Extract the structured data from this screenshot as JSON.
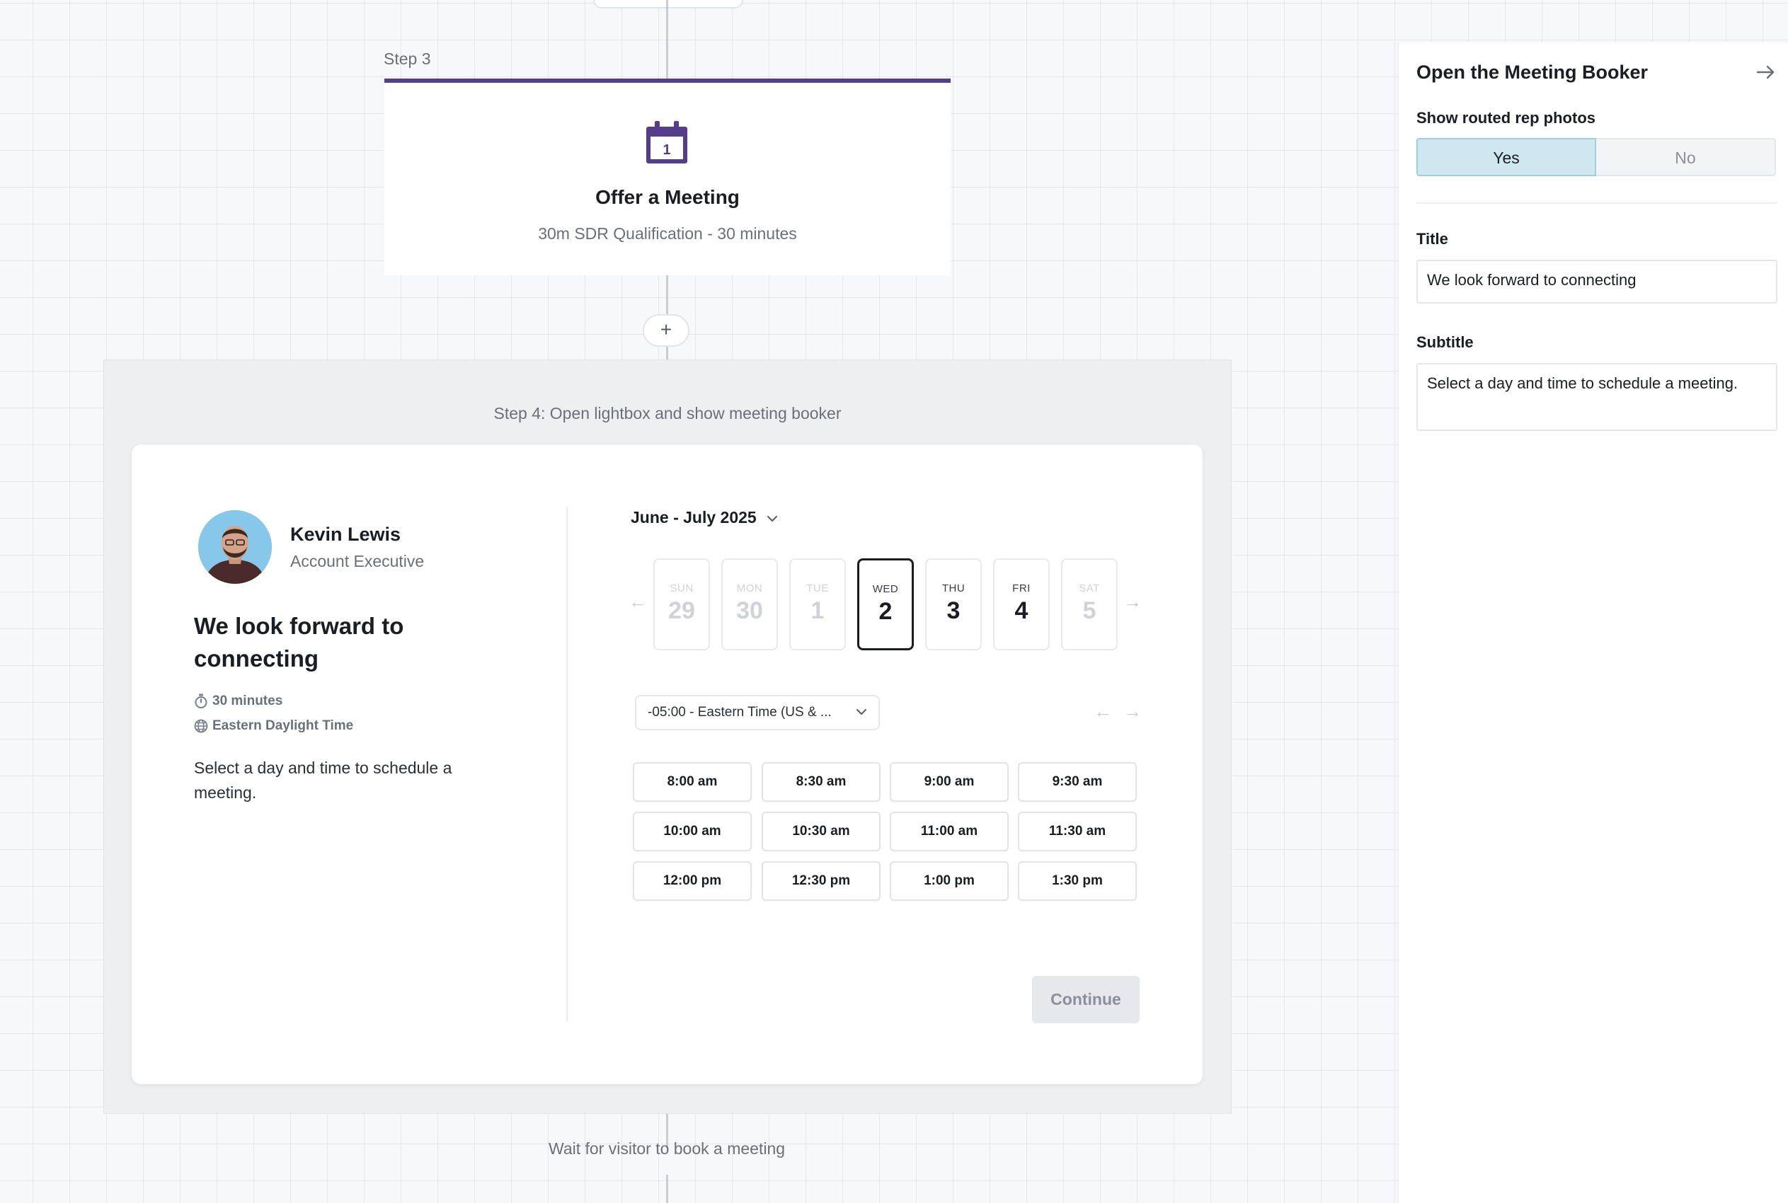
{
  "flow": {
    "step3": {
      "label": "Step 3",
      "card_title": "Offer a Meeting",
      "card_subtitle": "30m SDR Qualification - 30 minutes",
      "icon": "calendar-icon",
      "accent_color": "#553d8b"
    },
    "add_step_symbol": "+",
    "step4": {
      "label": "Step 4: Open lightbox and show meeting booker"
    },
    "wait_label": "Wait for visitor to book a meeting"
  },
  "booker": {
    "rep": {
      "name": "Kevin Lewis",
      "role": "Account Executive"
    },
    "title": "We look forward to connecting",
    "duration": "30 minutes",
    "timezone_name": "Eastern Daylight Time",
    "description": "Select a day and time to schedule a meeting.",
    "month_label": "June - July 2025",
    "days": [
      {
        "dow": "SUN",
        "date": "29",
        "state": "disabled"
      },
      {
        "dow": "MON",
        "date": "30",
        "state": "disabled"
      },
      {
        "dow": "TUE",
        "date": "1",
        "state": "disabled"
      },
      {
        "dow": "WED",
        "date": "2",
        "state": "selected"
      },
      {
        "dow": "THU",
        "date": "3",
        "state": "enabled"
      },
      {
        "dow": "FRI",
        "date": "4",
        "state": "enabled"
      },
      {
        "dow": "SAT",
        "date": "5",
        "state": "disabled"
      }
    ],
    "timezone_select": "-05:00 - Eastern Time (US & ...",
    "slots": [
      "8:00 am",
      "8:30 am",
      "9:00 am",
      "9:30 am",
      "10:00 am",
      "10:30 am",
      "11:00 am",
      "11:30 am",
      "12:00 pm",
      "12:30 pm",
      "1:00 pm",
      "1:30 pm"
    ],
    "continue_label": "Continue"
  },
  "panel": {
    "title": "Open the Meeting Booker",
    "show_photos_label": "Show routed rep photos",
    "yes_label": "Yes",
    "no_label": "No",
    "selected_option": "Yes",
    "title_label": "Title",
    "title_value": "We look forward to connecting",
    "subtitle_label": "Subtitle",
    "subtitle_value": "Select a day and time to schedule a meeting."
  }
}
